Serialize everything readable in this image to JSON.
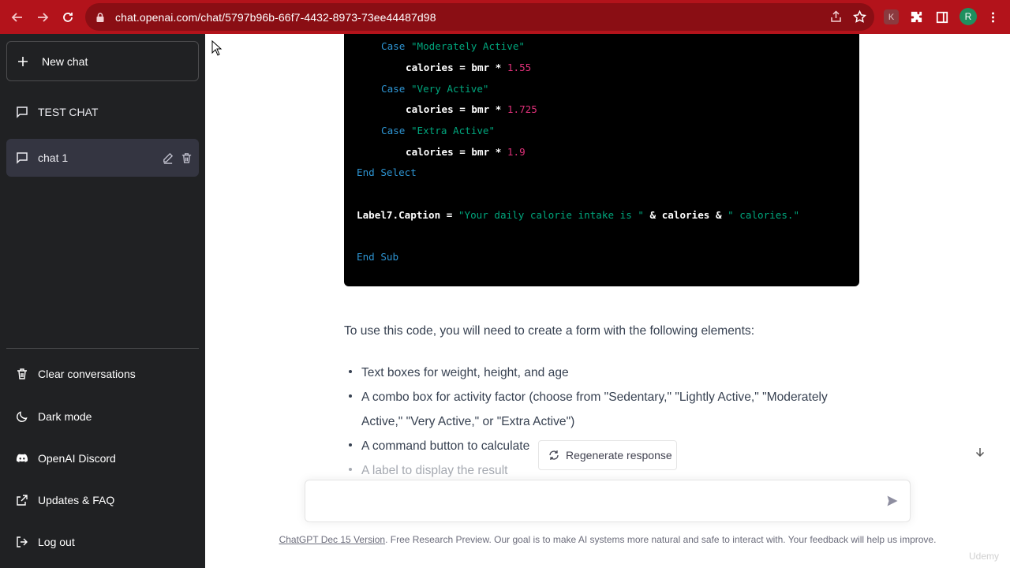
{
  "browser": {
    "url": "chat.openai.com/chat/5797b96b-66f7-4432-8973-73ee44487d98",
    "extension_badge": "K",
    "profile_initial": "R"
  },
  "sidebar": {
    "new_chat_label": "New chat",
    "conversations": [
      {
        "label": "TEST CHAT",
        "active": false
      },
      {
        "label": "chat 1",
        "active": true
      }
    ],
    "menu": [
      {
        "label": "Clear conversations",
        "icon": "trash-icon"
      },
      {
        "label": "Dark mode",
        "icon": "moon-icon"
      },
      {
        "label": "OpenAI Discord",
        "icon": "discord-icon"
      },
      {
        "label": "Updates & FAQ",
        "icon": "external-link-icon"
      },
      {
        "label": "Log out",
        "icon": "logout-icon"
      }
    ]
  },
  "code": {
    "l1_kw": "Case",
    "l1_str": "\"Moderately Active\"",
    "l2_plain": "calories = bmr * ",
    "l2_num": "1.55",
    "l3_kw": "Case",
    "l3_str": "\"Very Active\"",
    "l4_plain": "calories = bmr * ",
    "l4_num": "1.725",
    "l5_kw": "Case",
    "l5_str": "\"Extra Active\"",
    "l6_plain": "calories = bmr * ",
    "l6_num": "1.9",
    "l7": "End Select",
    "l8_a": "Label7.Caption = ",
    "l8_b": "\"Your daily calorie intake is \"",
    "l8_c": " & calories & ",
    "l8_d": "\" calories.\"",
    "l9": "End Sub"
  },
  "answer": {
    "intro": "To use this code, you will need to create a form with the following elements:",
    "bullets": [
      "Text boxes for weight, height, and age",
      "A combo box for activity factor (choose from \"Sedentary,\" \"Lightly Active,\" \"Moderately",
      "Active,\" \"Very Active,\" or \"Extra Active\")",
      "A command button to calculate",
      "A label to display the result"
    ]
  },
  "regenerate_label": "Regenerate response",
  "input": {
    "placeholder": ""
  },
  "footer": {
    "link": "ChatGPT Dec 15 Version",
    "text": ". Free Research Preview. Our goal is to make AI systems more natural and safe to interact with. Your feedback will help us improve."
  },
  "watermark": "Udemy",
  "colors": {
    "browser_bar": "#b3131b",
    "sidebar_bg": "#202123",
    "active_conv_bg": "#343541",
    "code_bg": "#000000",
    "code_keyword": "#2e95d3",
    "code_string": "#00a67d",
    "code_number": "#df3079"
  }
}
